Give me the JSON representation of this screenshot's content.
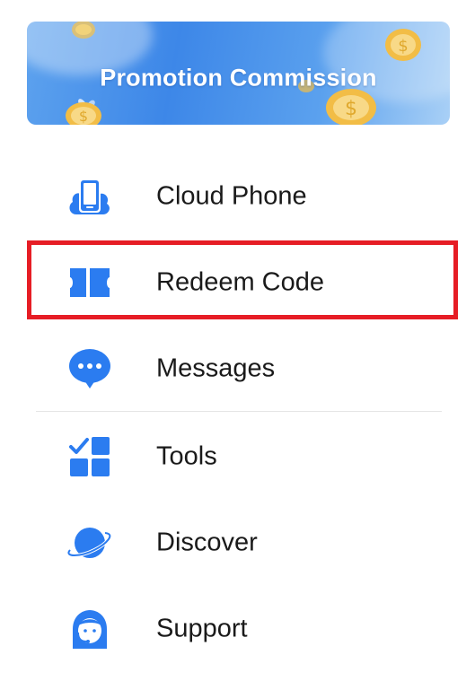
{
  "banner": {
    "title": "Promotion Commission"
  },
  "menu": {
    "items": [
      {
        "label": "Cloud Phone",
        "icon": "cloud-phone-icon"
      },
      {
        "label": "Redeem Code",
        "icon": "ticket-icon"
      },
      {
        "label": "Messages",
        "icon": "chat-bubble-icon"
      },
      {
        "label": "Tools",
        "icon": "tools-grid-icon"
      },
      {
        "label": "Discover",
        "icon": "planet-icon"
      },
      {
        "label": "Support",
        "icon": "support-agent-icon"
      }
    ]
  },
  "colors": {
    "icon_blue": "#2b7cf0",
    "highlight_red": "#e61d25",
    "text": "#1a1a1a",
    "divider": "#e5e5e5"
  }
}
